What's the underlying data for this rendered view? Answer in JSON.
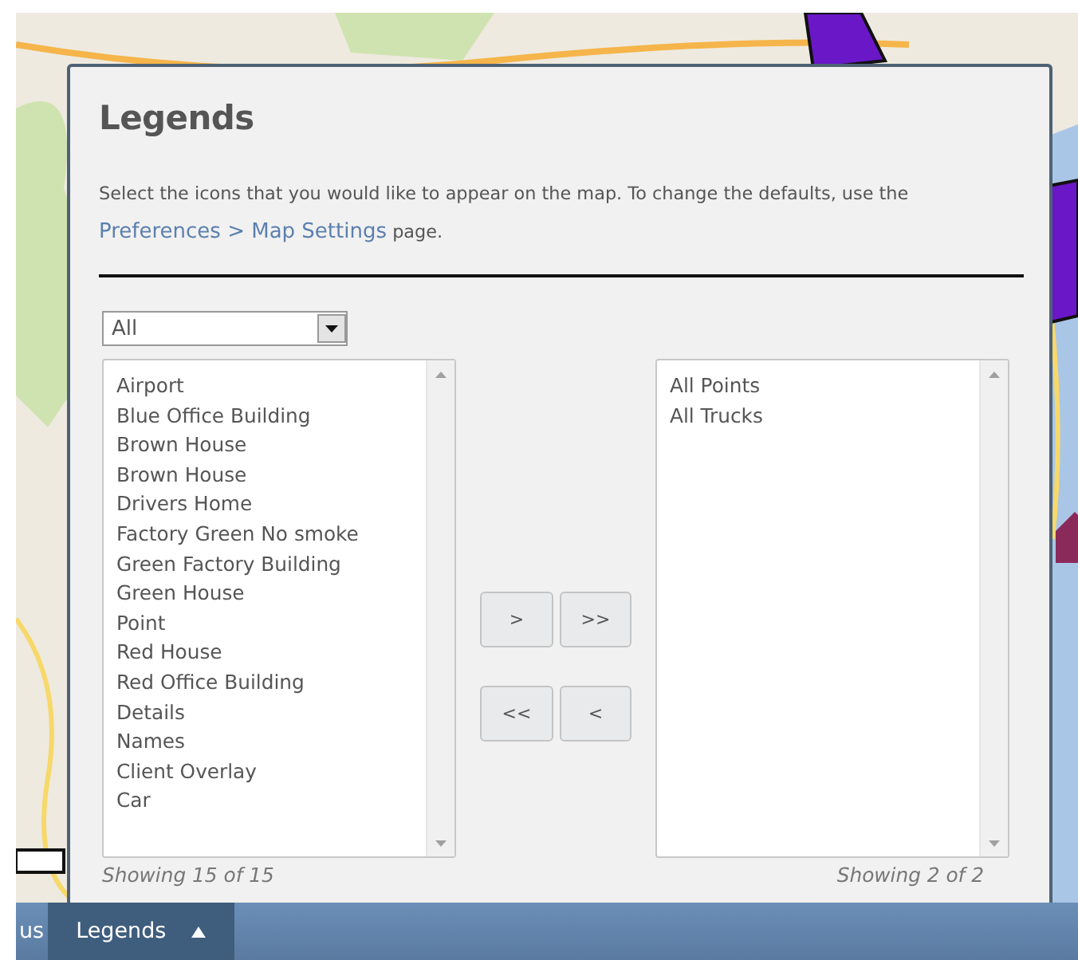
{
  "dialog": {
    "title": "Legends",
    "description": "Select the icons that you would like to appear on the map. To change the defaults, use the",
    "link": "Preferences > Map Settings",
    "description_end": "page."
  },
  "filter": {
    "value": "All"
  },
  "available": {
    "items": [
      "Airport",
      "Blue Office Building",
      "Brown House",
      "Brown House",
      "Drivers Home",
      "Factory Green No smoke",
      "Green Factory Building",
      "Green House",
      "Point",
      "Red House",
      "Red Office Building",
      "Details",
      "Names",
      "Client Overlay",
      "Car"
    ],
    "footer": "Showing 15 of 15"
  },
  "chosen": {
    "items": [
      "All Points",
      "All Trucks"
    ],
    "footer": "Showing 2 of 2"
  },
  "move_buttons": [
    ">",
    ">>",
    "<<",
    "<"
  ],
  "taskbar": {
    "tabs": [
      {
        "label": "us",
        "selected": false,
        "caret": false
      },
      {
        "label": "Legends",
        "selected": true,
        "caret": true
      }
    ]
  }
}
